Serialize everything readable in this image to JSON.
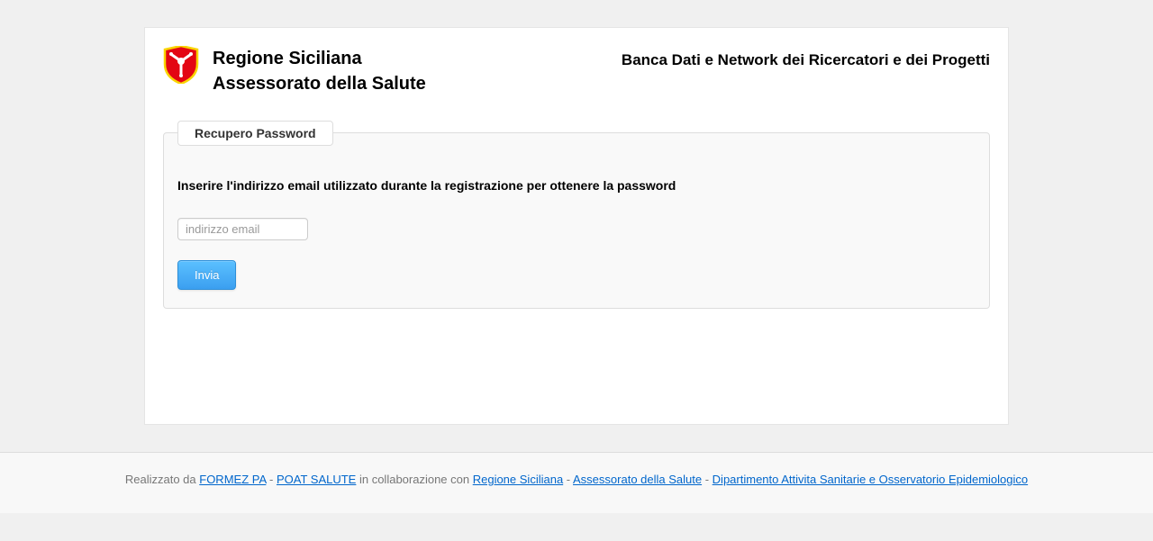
{
  "header": {
    "logo_line1": "Regione Siciliana",
    "logo_line2": "Assessorato della Salute",
    "right": "Banca Dati e Network dei Ricercatori e dei Progetti"
  },
  "form": {
    "legend": "Recupero Password",
    "label": "Inserire l'indirizzo email utilizzato durante la registrazione per ottenere la password",
    "email_placeholder": "indirizzo email",
    "submit": "Invia"
  },
  "footer": {
    "prefix": "Realizzato da ",
    "link1": "FORMEZ PA",
    "sep1": " - ",
    "link2": "POAT SALUTE",
    "mid": " in collaborazione con ",
    "link3": "Regione Siciliana",
    "sep2": " - ",
    "link4": "Assessorato della Salute",
    "sep3": " - ",
    "link5": "Dipartimento Attivita Sanitarie e Osservatorio Epidemiologico"
  }
}
